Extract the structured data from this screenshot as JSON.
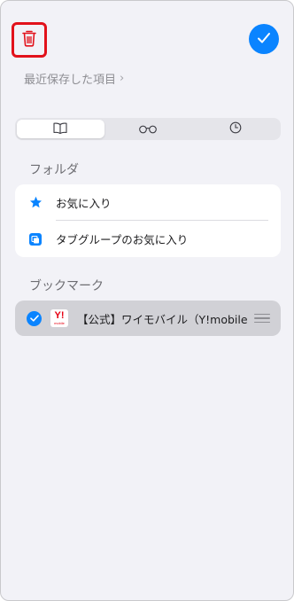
{
  "toolbar": {
    "trash_icon": "trash-icon",
    "done_icon": "checkmark-icon",
    "accent_color": "#0a84ff",
    "highlight_color": "#e2121b"
  },
  "recent": {
    "label": "最近保存した項目",
    "chevron": "›"
  },
  "segments": [
    {
      "icon": "book-icon",
      "selected": true
    },
    {
      "icon": "reading-glasses-icon",
      "selected": false
    },
    {
      "icon": "clock-icon",
      "selected": false
    }
  ],
  "folders": {
    "title": "フォルダ",
    "items": [
      {
        "label": "お気に入り",
        "icon": "star-icon"
      },
      {
        "label": "タブグループのお気に入り",
        "icon": "tab-group-icon"
      }
    ]
  },
  "bookmarks": {
    "title": "ブックマーク",
    "items": [
      {
        "label": "【公式】ワイモバイル（Y!mobile...",
        "favicon_text": "Y!",
        "favicon_sub": "mobile",
        "checked": true
      }
    ]
  }
}
